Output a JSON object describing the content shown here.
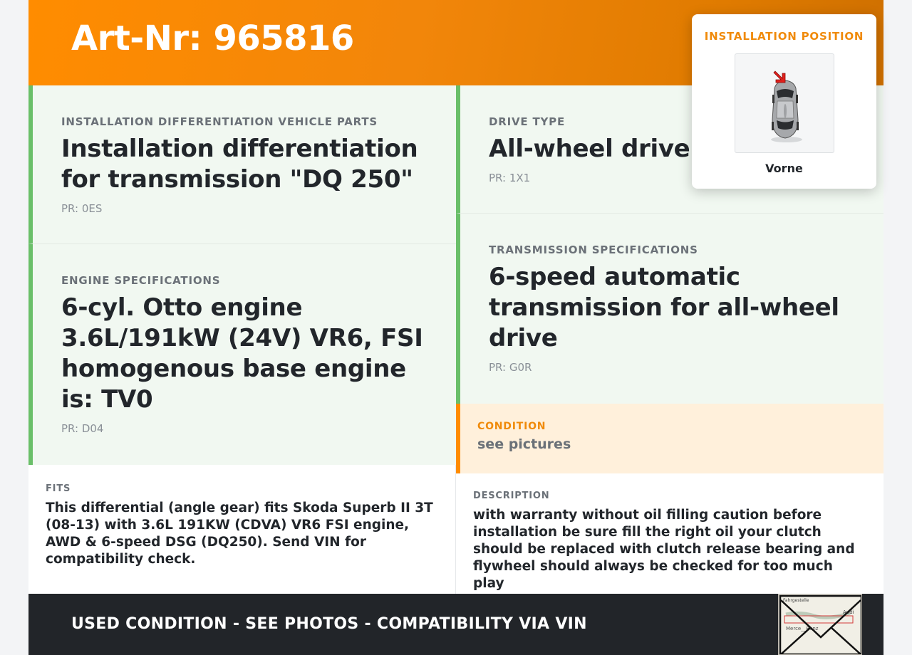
{
  "header": {
    "art_nr": "Art-Nr: 965816"
  },
  "cells": {
    "installation_diff": {
      "label": "INSTALLATION DIFFERENTIATION VEHICLE PARTS",
      "value": "Installation differentiation for transmission \"DQ 250\"",
      "pr": "PR: 0ES"
    },
    "drive_type": {
      "label": "DRIVE TYPE",
      "value": "All-wheel drive",
      "pr": "PR: 1X1"
    },
    "engine": {
      "label": "ENGINE SPECIFICATIONS",
      "value": "6-cyl. Otto engine 3.6L/191kW (24V) VR6, FSI homogenous base engine is: TV0",
      "pr": "PR: D04"
    },
    "transmission": {
      "label": "TRANSMISSION SPECIFICATIONS",
      "value": "6-speed automatic transmission for all-wheel drive",
      "pr": "PR: G0R"
    }
  },
  "condition": {
    "label": "CONDITION",
    "value": "see pictures"
  },
  "fits": {
    "label": "FITS",
    "value": "This differential (angle gear) fits Skoda Superb II 3T (08-13) with 3.6L 191KW (CDVA) VR6 FSI engine, AWD & 6-speed DSG (DQ250). Send VIN for compatibility check."
  },
  "description": {
    "label": "DESCRIPTION",
    "value": "with warranty without oil filling caution before installation be sure fill the right oil your clutch should be replaced with clutch release bearing and flywheel should always be checked for too much play"
  },
  "footer": {
    "text": "USED CONDITION - SEE PHOTOS - COMPATIBILITY VIA VIN",
    "stamp_lines": [
      "Fahrgestelle",
      "Audi",
      "Merce__Benz"
    ]
  },
  "installation_position": {
    "title": "INSTALLATION POSITION",
    "position": "Vorne",
    "icon": "car-top-view-icon",
    "arrow_icon": "red-arrow-icon"
  },
  "colors": {
    "accent": "#ff8c00",
    "green_border": "#6abf69",
    "cell_bg": "#f1f8f1",
    "condition_bg": "#fff0db",
    "footer_bg": "#222529"
  }
}
